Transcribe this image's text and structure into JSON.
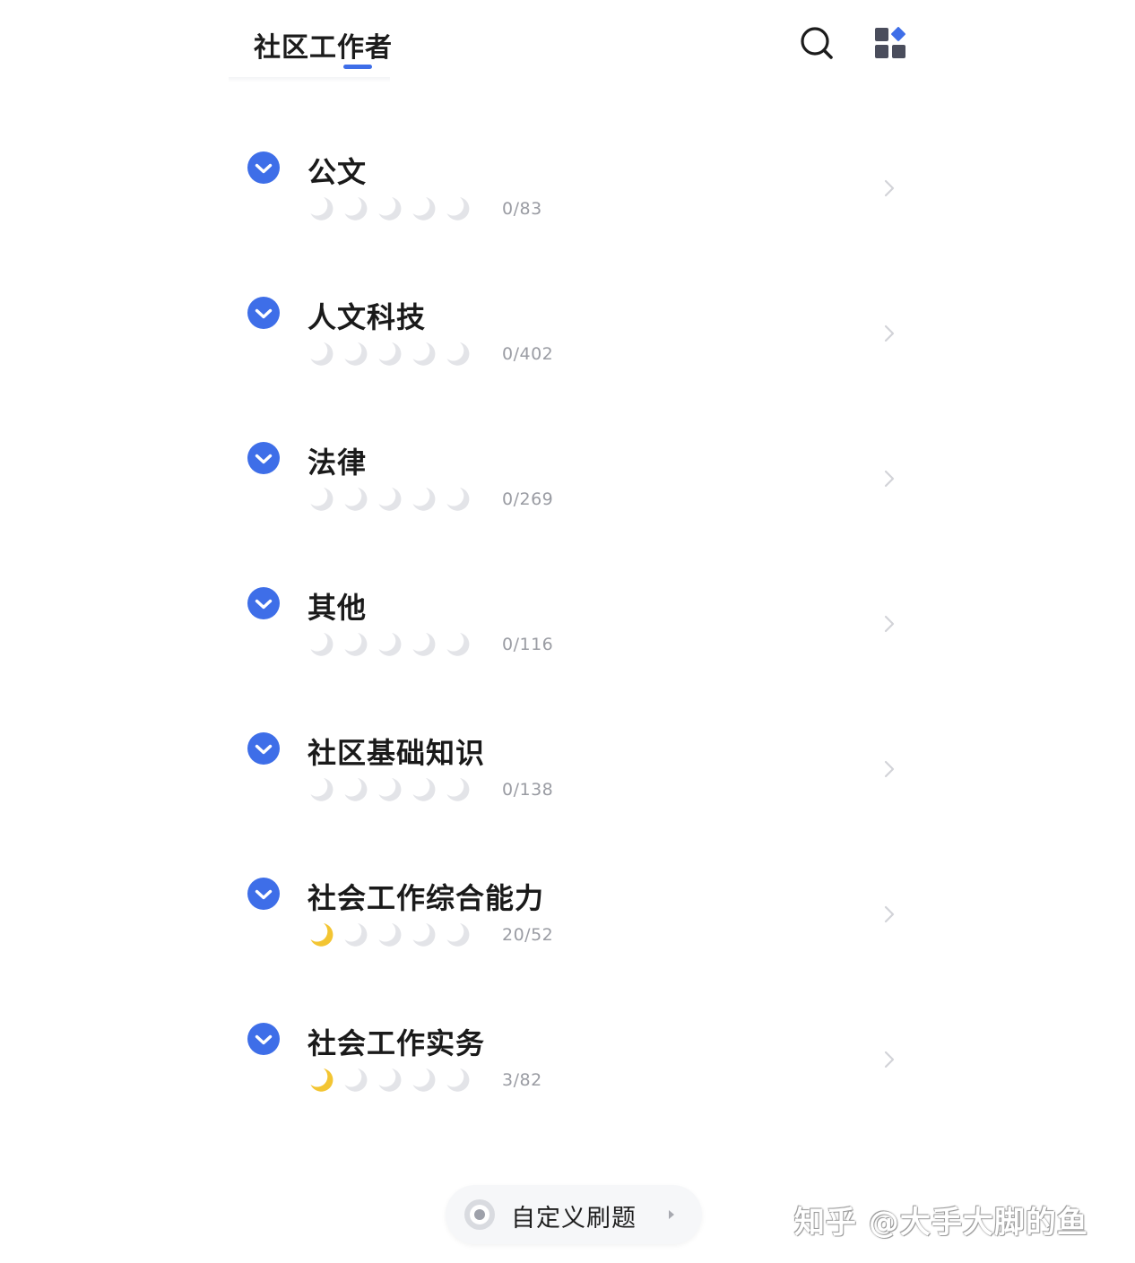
{
  "header": {
    "tab_title": "社区工作者",
    "accent_color": "#3e6ee8",
    "icons": [
      "search-icon",
      "grid-apps-icon"
    ]
  },
  "categories": [
    {
      "title": "公文",
      "progress": "0/83",
      "filled_moons": 0,
      "total_moons": 5
    },
    {
      "title": "人文科技",
      "progress": "0/402",
      "filled_moons": 0,
      "total_moons": 5
    },
    {
      "title": "法律",
      "progress": "0/269",
      "filled_moons": 0,
      "total_moons": 5
    },
    {
      "title": "其他",
      "progress": "0/116",
      "filled_moons": 0,
      "total_moons": 5
    },
    {
      "title": "社区基础知识",
      "progress": "0/138",
      "filled_moons": 0,
      "total_moons": 5
    },
    {
      "title": "社会工作综合能力",
      "progress": "20/52",
      "filled_moons": 1,
      "total_moons": 5
    },
    {
      "title": "社会工作实务",
      "progress": "3/82",
      "filled_moons": 1,
      "total_moons": 5
    }
  ],
  "colors": {
    "check_circle": "#3e6ee8",
    "moon_filled": "#f3c532",
    "moon_empty": "#e3e4e8",
    "muted_text": "#9a9ca3"
  },
  "bottom": {
    "custom_practice_label": "自定义刷题"
  },
  "watermark": "知乎 @大手大脚的鱼"
}
